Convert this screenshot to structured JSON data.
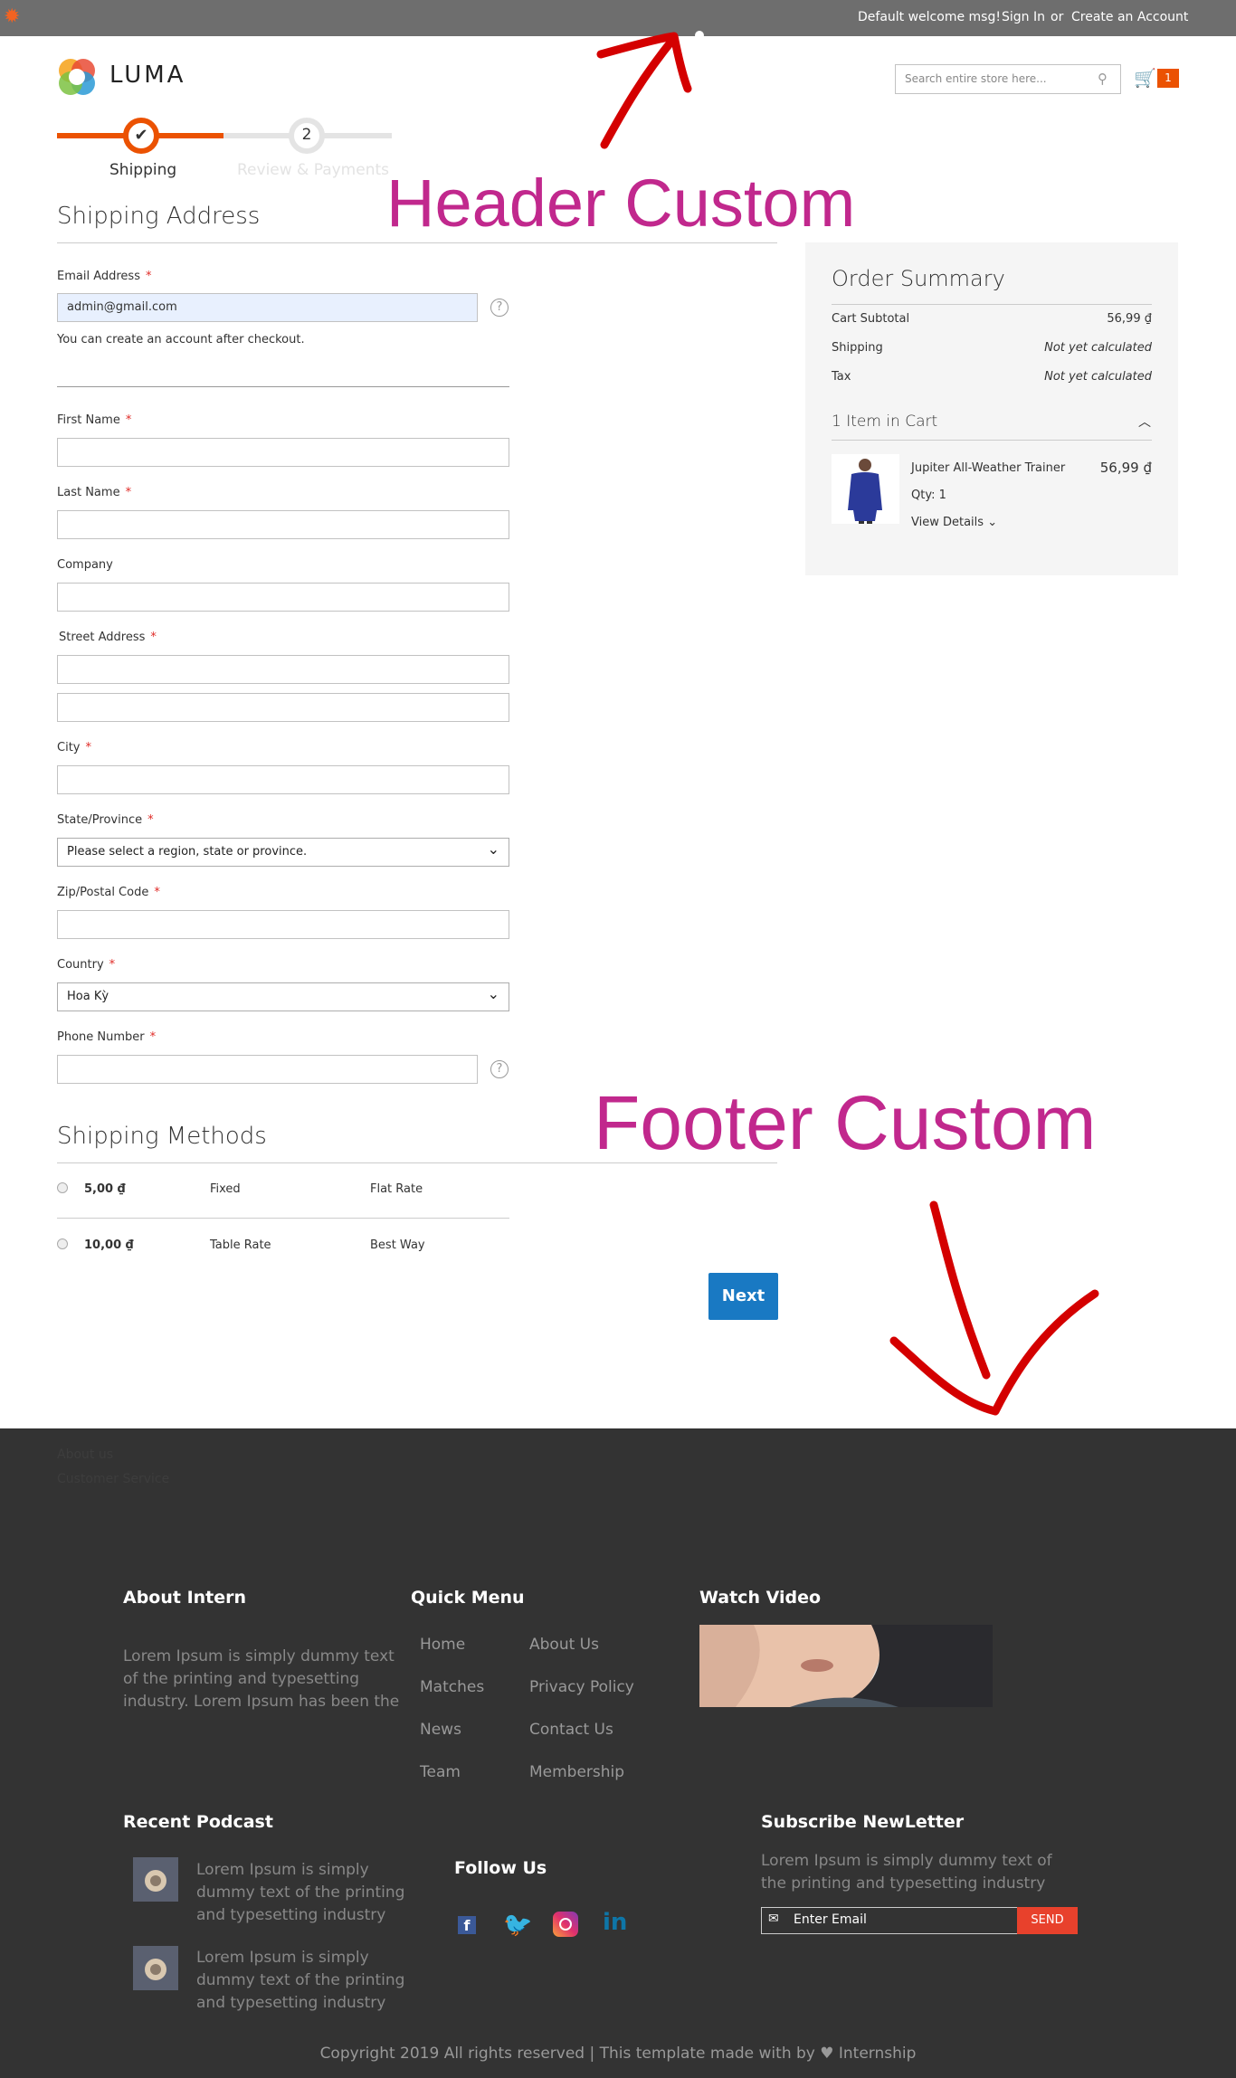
{
  "header": {
    "welcome": "Default welcome msg!",
    "sign_in": "Sign In",
    "or": "or",
    "create_account": "Create an Account",
    "logo": "LUMA",
    "search_placeholder": "Search entire store here...",
    "cart_count": "1"
  },
  "steps": {
    "step1_label": "Shipping",
    "step2_number": "2",
    "step2_label": "Review & Payments"
  },
  "annotations": {
    "header_custom": "Header Custom",
    "footer_custom": "Footer Custom"
  },
  "shipping_address": {
    "title": "Shipping Address",
    "email_label": "Email Address",
    "email_value": "admin@gmail.com",
    "email_note": "You can create an account after checkout.",
    "first_name_label": "First Name",
    "last_name_label": "Last Name",
    "company_label": "Company",
    "street_label": "Street Address",
    "city_label": "City",
    "state_label": "State/Province",
    "state_value": "Please select a region, state or province.",
    "zip_label": "Zip/Postal Code",
    "country_label": "Country",
    "country_value": "Hoa Kỳ",
    "phone_label": "Phone Number",
    "required_mark": "*",
    "help_mark": "?"
  },
  "order_summary": {
    "title": "Order Summary",
    "subtotal_label": "Cart Subtotal",
    "subtotal_value": "56,99 ₫",
    "shipping_label": "Shipping",
    "shipping_value": "Not yet calculated",
    "tax_label": "Tax",
    "tax_value": "Not yet calculated",
    "items_label": "1 Item in Cart",
    "product_name": "Jupiter All-Weather Trainer",
    "product_price": "56,99 ₫",
    "product_qty": "Qty: 1",
    "view_details": "View Details"
  },
  "shipping_methods": {
    "title": "Shipping Methods",
    "methods": [
      {
        "price": "5,00 ₫",
        "method": "Fixed",
        "carrier": "Flat Rate"
      },
      {
        "price": "10,00 ₫",
        "method": "Table Rate",
        "carrier": "Best Way"
      }
    ],
    "next_button": "Next"
  },
  "footer": {
    "links": [
      "About us",
      "Customer Service"
    ],
    "about_title": "About Intern",
    "about_text": "Lorem Ipsum is simply dummy text of the printing and typesetting industry. Lorem Ipsum has been the",
    "quick_menu_title": "Quick Menu",
    "quick_menu_col1": [
      "Home",
      "Matches",
      "News",
      "Team"
    ],
    "quick_menu_col2": [
      "About Us",
      "Privacy Policy",
      "Contact Us",
      "Membership"
    ],
    "watch_video_title": "Watch Video",
    "podcast_title": "Recent Podcast",
    "podcast_items": [
      "Lorem Ipsum is simply dummy text of the printing and typesetting industry",
      "Lorem Ipsum is simply dummy text of the printing and typesetting industry"
    ],
    "follow_title": "Follow Us",
    "subscribe_title": "Subscribe NewLetter",
    "subscribe_text": "Lorem Ipsum is simply dummy text of the printing and typesetting industry",
    "email_placeholder": "Enter Email",
    "send_button": "SEND",
    "copyright": "Copyright 2019 All rights reserved | This template made with by ♥ Internship"
  },
  "colors": {
    "accent_orange": "#eb5202",
    "primary_blue": "#1979c3",
    "annotation_magenta": "#c1288d",
    "annotation_red": "#d40000",
    "send_red": "#e8412c"
  }
}
